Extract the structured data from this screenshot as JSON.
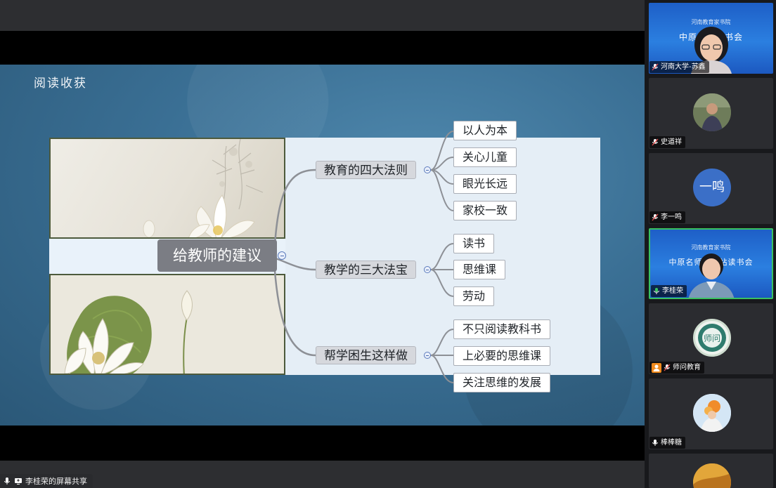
{
  "slide": {
    "title": "阅读收获",
    "mindmap": {
      "center": "给教师的建议",
      "branches": [
        {
          "label": "教育的四大法则",
          "leaves": [
            "以人为本",
            "关心儿童",
            "眼光长远",
            "家校一致"
          ]
        },
        {
          "label": "教学的三大法宝",
          "leaves": [
            "读书",
            "思维课",
            "劳动"
          ]
        },
        {
          "label": "帮学困生这样做",
          "leaves": [
            "不只阅读教科书",
            "上必要的思维课",
            "关注思维的发展"
          ]
        }
      ]
    }
  },
  "share_bar": {
    "label": "李桂荣的屏幕共享"
  },
  "participants": [
    {
      "name": "河南大学-苏鑫",
      "banner": "中原名师读书会",
      "banner_sub": "河南教育家书院"
    },
    {
      "name": "史道祥"
    },
    {
      "name": "李一鸣",
      "initials": "一鸣",
      "avatar_color": "#3b6fc7"
    },
    {
      "name": "李桂荣",
      "banner": "中原名师工作站读书会",
      "banner_sub": "河南教育家书院",
      "active": true
    },
    {
      "name": "师问教育",
      "logo": "师问"
    },
    {
      "name": "棒棒糖"
    },
    {
      "name": ""
    }
  ],
  "colors": {
    "accent_active": "#39c160",
    "slide_bg": "#3a6f94",
    "center_node": "#7b7d84"
  }
}
